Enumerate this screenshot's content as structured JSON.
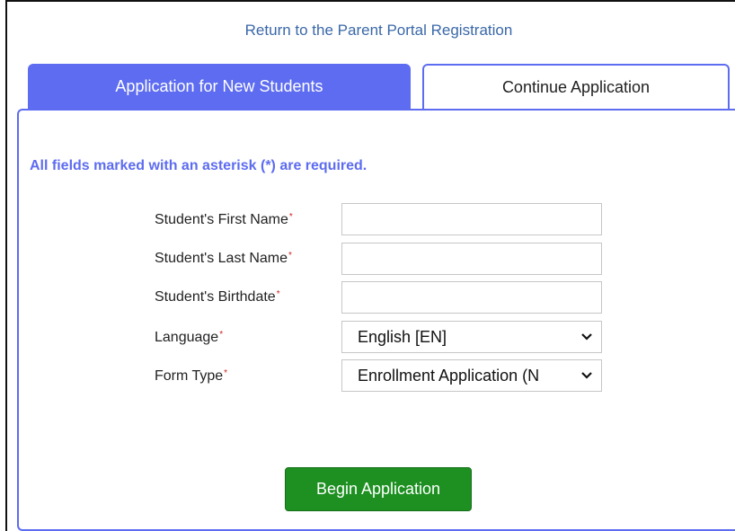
{
  "header": {
    "return_link": "Return to the Parent Portal Registration"
  },
  "tabs": [
    {
      "label": "Application for New Students",
      "active": true
    },
    {
      "label": "Continue Application",
      "active": false
    }
  ],
  "form": {
    "required_note": "All fields marked with an asterisk (*) are required.",
    "required_marker": "*",
    "fields": {
      "first_name": {
        "label": "Student's First Name",
        "value": ""
      },
      "last_name": {
        "label": "Student's Last Name",
        "value": ""
      },
      "birthdate": {
        "label": "Student's Birthdate",
        "value": ""
      },
      "language": {
        "label": "Language",
        "selected": "English [EN]"
      },
      "form_type": {
        "label": "Form Type",
        "selected": "Enrollment Application (N"
      }
    },
    "submit_label": "Begin Application"
  },
  "colors": {
    "accent": "#5d6cf0",
    "link": "#3a68a8",
    "button_green": "#1d9021",
    "required_red": "#d21e1e"
  },
  "icons": {
    "select_arrow": "chevron-down-icon"
  }
}
